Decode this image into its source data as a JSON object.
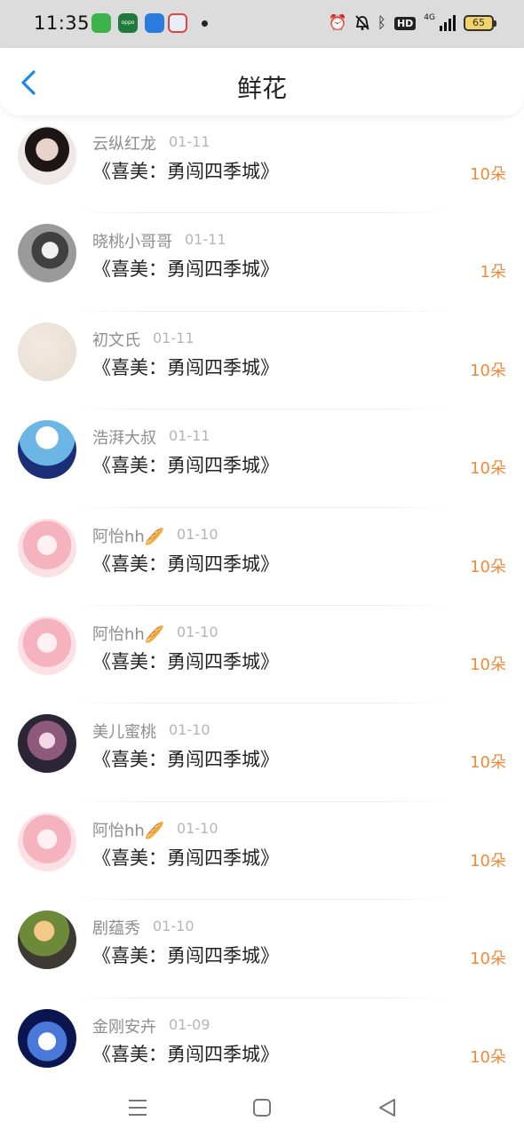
{
  "status_bar": {
    "time": "11:35",
    "battery": "65",
    "network": "4G",
    "hd": "HD",
    "icons": [
      "alarm-icon",
      "bell-off-icon",
      "bluetooth-icon",
      "hd-icon",
      "signal-icon",
      "battery-icon"
    ],
    "apps": [
      {
        "name": "green-app-icon",
        "color": "#3bb34a"
      },
      {
        "name": "oppo-app-icon",
        "color": "#1f7a3e"
      },
      {
        "name": "blue-app-icon",
        "color": "#2a7be0"
      },
      {
        "name": "baidu-app-icon",
        "color": "#e8eef8"
      }
    ]
  },
  "header": {
    "title": "鲜花",
    "back_icon": "chevron-left-icon",
    "accent": "#1e88e5"
  },
  "flowers": [
    {
      "name": "云纵红龙",
      "date": "01-11",
      "book": "《喜美：勇闯四季城》",
      "count": "10朵",
      "avatar": "girl-photo"
    },
    {
      "name": "晓桃小哥哥",
      "date": "01-11",
      "book": "《喜美：勇闯四季城》",
      "count": "1朵",
      "avatar": "bw-photo"
    },
    {
      "name": "初文氏",
      "date": "01-11",
      "book": "《喜美：勇闯四季城》",
      "count": "10朵",
      "avatar": "paper-texture"
    },
    {
      "name": "浩湃大叔",
      "date": "01-11",
      "book": "《喜美：勇闯四季城》",
      "count": "10朵",
      "avatar": "cloud-scene"
    },
    {
      "name": "阿怡hh🥖",
      "date": "01-10",
      "book": "《喜美：勇闯四季城》",
      "count": "10朵",
      "avatar": "pink-anime"
    },
    {
      "name": "阿怡hh🥖",
      "date": "01-10",
      "book": "《喜美：勇闯四季城》",
      "count": "10朵",
      "avatar": "pink-anime"
    },
    {
      "name": "美儿蜜桃",
      "date": "01-10",
      "book": "《喜美：勇闯四季城》",
      "count": "10朵",
      "avatar": "anime-dark"
    },
    {
      "name": "阿怡hh🥖",
      "date": "01-10",
      "book": "《喜美：勇闯四季城》",
      "count": "10朵",
      "avatar": "pink-anime"
    },
    {
      "name": "剧蕴秀",
      "date": "01-10",
      "book": "《喜美：勇闯四季城》",
      "count": "10朵",
      "avatar": "kid-photo"
    },
    {
      "name": "金刚安卉",
      "date": "01-09",
      "book": "《喜美：勇闯四季城》",
      "count": "10朵",
      "avatar": "space-cartoon"
    }
  ],
  "colors": {
    "count": "#ef8a3a",
    "name": "#8e8e8e",
    "date": "#b5b5b5",
    "book": "#222222"
  },
  "nav": [
    "menu-icon",
    "home-square-icon",
    "back-triangle-icon"
  ]
}
